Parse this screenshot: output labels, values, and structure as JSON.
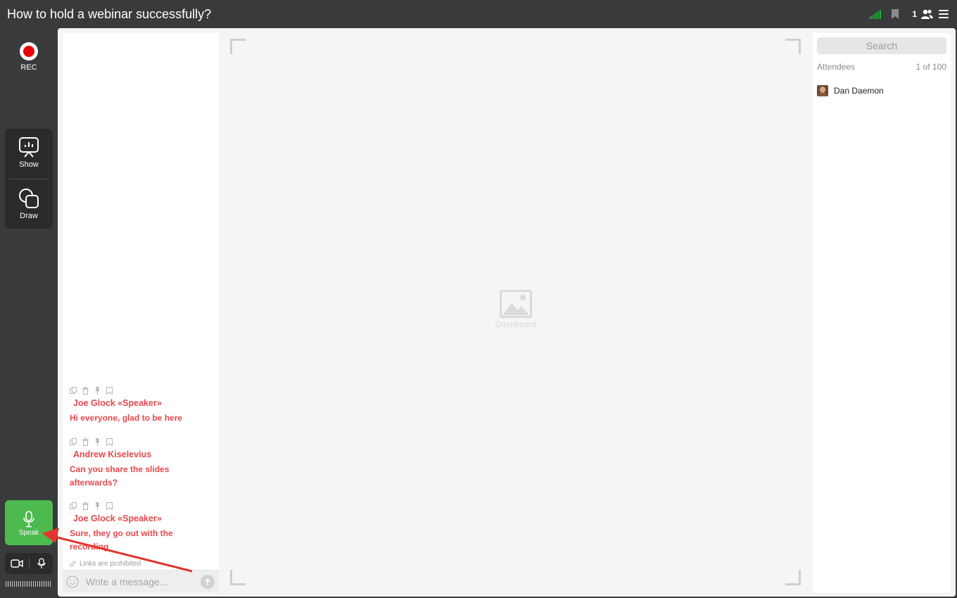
{
  "header": {
    "title": "How to hold a webinar successfully?",
    "attendee_count": "1"
  },
  "rail": {
    "rec_label": "REC",
    "show_label": "Show",
    "draw_label": "Draw",
    "speak_label": "Speak"
  },
  "chat": {
    "messages": [
      {
        "author": "Joe Glock «Speaker»",
        "text": "Hi everyone, glad to be here"
      },
      {
        "author": "Andrew Kiselevius",
        "text": "Can you share the slides afterwards?"
      },
      {
        "author": "Joe Glock «Speaker»",
        "text": "Sure, they go out with the recording"
      }
    ],
    "links_note": "Links are prohibited",
    "input_placeholder": "Write a message..."
  },
  "dashboard": {
    "label": "Dashboard"
  },
  "attendees": {
    "search_placeholder": "Search",
    "label": "Attendees",
    "range": "1 of 100",
    "list": [
      {
        "name": "Dan Daemon"
      }
    ]
  },
  "colors": {
    "accent_green": "#4cba4f",
    "rec_red": "#e8000b",
    "chat_red": "#e8474b",
    "signal_green": "#1ea83a"
  }
}
